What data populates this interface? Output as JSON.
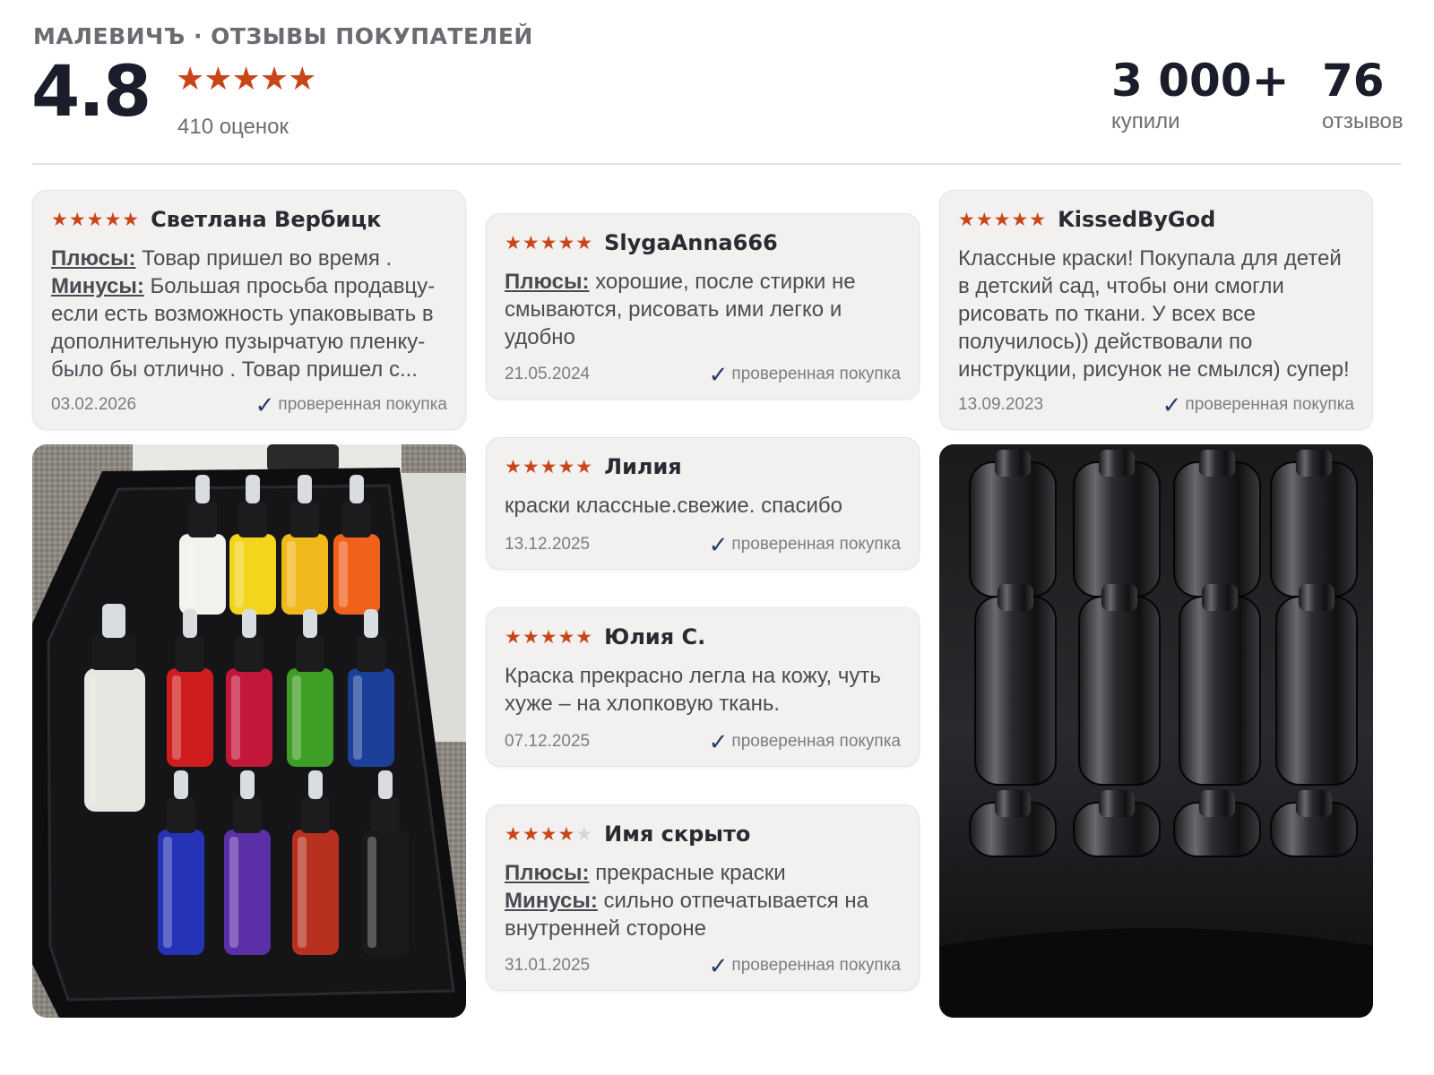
{
  "header": {
    "brand": "МАЛЕВИЧЪ · ОТЗЫВЫ ПОКУПАТЕЛЕЙ",
    "rating": "4.8",
    "stars": "★★★★★",
    "ratings_count": "410 оценок",
    "bought_value": "3 000+",
    "bought_label": "купили",
    "reviews_value": "76",
    "reviews_label": "отзывов"
  },
  "labels": {
    "plus": "Плюсы:",
    "minus": "Минусы:",
    "verified": "проверенная покупка"
  },
  "reviews": [
    {
      "stars": "★★★★★",
      "author": "Светлана Вербицк",
      "plus": "Товар пришел во время .",
      "minus": "Большая просьба продавцу- если есть возможность упаковывать в дополнительную пузырчатую пленку- было бы отлично . Товар пришел с...",
      "date": "03.02.2026"
    },
    {
      "stars": "★★★★★",
      "author": "SlygaAnna666",
      "plus": "хорошие, после стирки не смываются, рисовать ими легко и удобно",
      "date": "21.05.2024"
    },
    {
      "stars": "★★★★★",
      "author": "KissedByGod",
      "text": "Классные краски! Покупала для детей в детский сад, чтобы они смогли рисовать по ткани. У всех все получилось)) действовали по инструкции, рисунок не смылся) супер!",
      "date": "13.09.2023"
    },
    {
      "stars": "★★★★★",
      "author": "Лилия",
      "text": "краски классные.свежие. спасибо",
      "date": "13.12.2025"
    },
    {
      "stars": "★★★★★",
      "author": "Юлия С.",
      "text": "Краска прекрасно легла на кожу, чуть хуже – на хлопковую ткань.",
      "date": "07.12.2025"
    },
    {
      "stars_filled": "★★★★",
      "stars_empty": "★",
      "rating": 4,
      "author": "Имя скрыто",
      "plus": "прекрасные краски",
      "minus": "сильно отпечатывается на внутренней стороне",
      "date": "31.01.2025"
    }
  ],
  "photos": {
    "photo1_icon": "paint-set-photo",
    "photo2_icon": "tray-closeup-photo"
  },
  "colors": {
    "star": "#c8471a",
    "card_bg": "#f2f1ef",
    "check": "#283a6e",
    "bottle_colors": [
      "#f2f2ee",
      "#f2d51c",
      "#f0b81a",
      "#f0611c",
      "#cf1c1c",
      "#c2173a",
      "#3f9e26",
      "#1c3f9a",
      "#2433b8",
      "#5a2fa8",
      "#b8301e",
      "#1a1a1a"
    ]
  }
}
